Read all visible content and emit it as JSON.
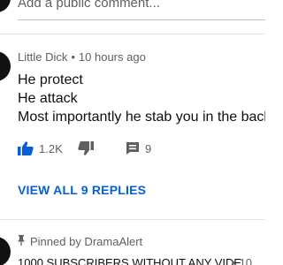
{
  "composer": {
    "placeholder": "Add a public comment..."
  },
  "comment": {
    "author": "Little Dick",
    "separator": "•",
    "time": "10 hours ago",
    "lines": [
      "He protect",
      "He attack",
      "Most importantly he stab you in the back"
    ],
    "like_icon": "thumbs-up-icon",
    "like_count": "1.2K",
    "dislike_icon": "thumbs-down-icon",
    "reply_icon": "comment-icon",
    "reply_count": "9"
  },
  "replies": {
    "label": "VIEW ALL 9 REPLIES"
  },
  "next_comment": {
    "pin_icon": "pin-icon",
    "pinned_label": "Pinned by DramaAlert",
    "text_partial": "1000 SUBSCRIBERS WITHOUT ANY VIDE",
    "separator": "•",
    "time_partial": "10"
  },
  "colors": {
    "accent": "#065fd4",
    "text_primary": "#0f0f0f",
    "text_secondary": "#606060",
    "divider": "#e5e5e5"
  }
}
